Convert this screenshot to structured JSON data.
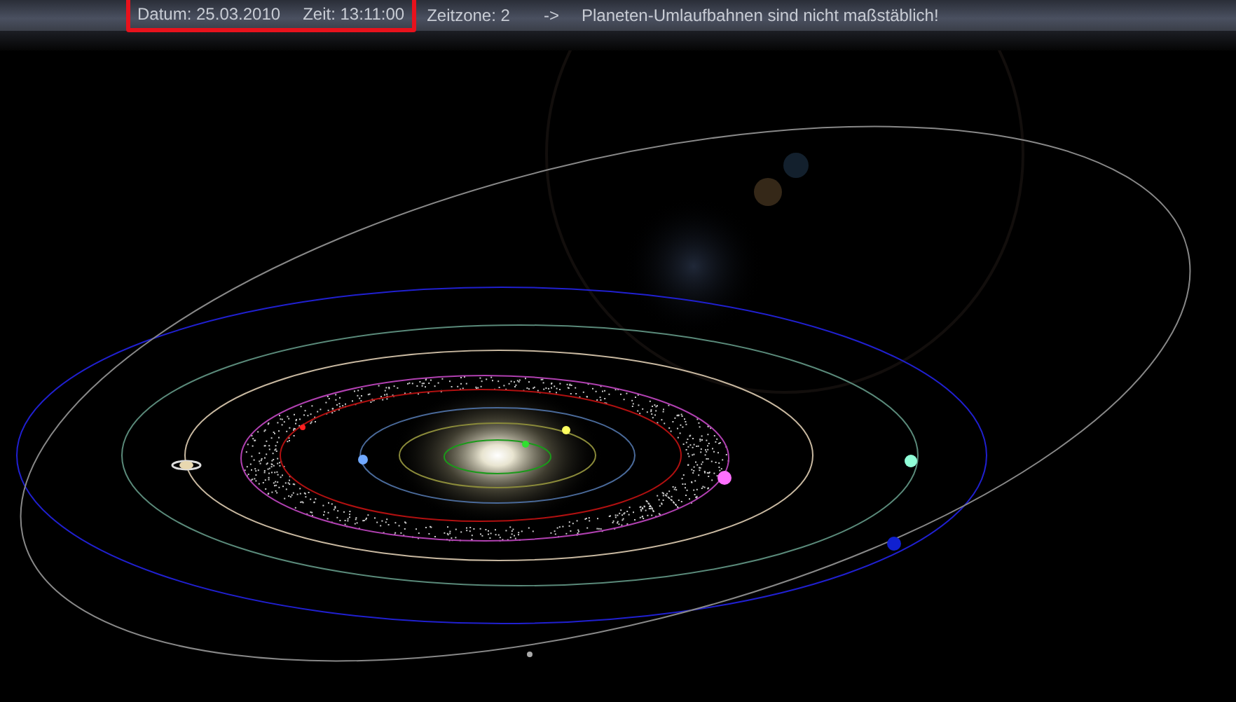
{
  "top_bar": {
    "datetime": {
      "highlighted": true,
      "date": "Datum:  25.03.2010",
      "time": "Zeit: 13:11:00"
    },
    "timezone": "Zeitzone: 2",
    "arrow": "->",
    "note": "Planeten-Umlaufbahnen sind nicht maßstäblich!"
  }
}
